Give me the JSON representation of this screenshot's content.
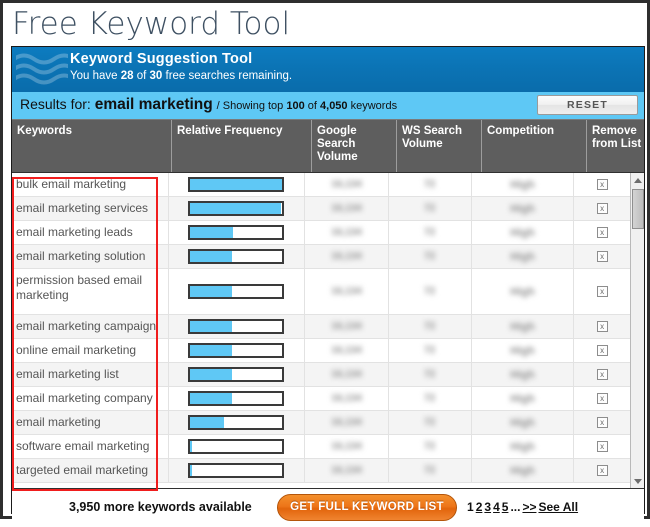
{
  "page": {
    "title": "Free Keyword Tool"
  },
  "brand": {
    "title": "Keyword Suggestion Tool",
    "subtitle_prefix": "You have ",
    "searches_used": "28",
    "subtitle_mid": " of ",
    "searches_total": "30",
    "subtitle_suffix": " free searches remaining.",
    "logo_icon": "waves-icon",
    "bg_color": "#0b73b4"
  },
  "results_bar": {
    "label": "Results for:",
    "keyword": "email marketing",
    "separator": "/",
    "showing_text": "Showing top ",
    "showing_count": "100",
    "showing_of": " of ",
    "total_keywords": "4,050",
    "showing_suffix": " keywords",
    "reset_label": "RESET",
    "bg_color": "#5ec8f5"
  },
  "table": {
    "headers": [
      "Keywords",
      "Relative Frequency",
      "Google Search Volume",
      "WS Search Volume",
      "Competition",
      "Remove from List"
    ],
    "header_bg": "#5e5e5e",
    "bar_color": "#5fc8f5",
    "remove_icon": "x-icon",
    "rows": [
      {
        "keyword": "bulk email marketing",
        "frequency_pct": 100,
        "google_volume": "16,134",
        "ws_volume": "72",
        "competition": "High",
        "remove": "x"
      },
      {
        "keyword": "email marketing services",
        "frequency_pct": 98,
        "google_volume": "16,134",
        "ws_volume": "72",
        "competition": "High",
        "remove": "x"
      },
      {
        "keyword": "email marketing leads",
        "frequency_pct": 46,
        "google_volume": "16,134",
        "ws_volume": "72",
        "competition": "High",
        "remove": "x"
      },
      {
        "keyword": "email marketing solution",
        "frequency_pct": 45,
        "google_volume": "16,134",
        "ws_volume": "72",
        "competition": "High",
        "remove": "x"
      },
      {
        "keyword": "permission based email marketing",
        "frequency_pct": 45,
        "google_volume": "16,134",
        "ws_volume": "72",
        "competition": "High",
        "remove": "x"
      },
      {
        "keyword": "email marketing campaign",
        "frequency_pct": 45,
        "google_volume": "16,134",
        "ws_volume": "72",
        "competition": "High",
        "remove": "x"
      },
      {
        "keyword": "online email marketing",
        "frequency_pct": 45,
        "google_volume": "16,134",
        "ws_volume": "72",
        "competition": "High",
        "remove": "x"
      },
      {
        "keyword": "email marketing list",
        "frequency_pct": 45,
        "google_volume": "16,134",
        "ws_volume": "72",
        "competition": "High",
        "remove": "x"
      },
      {
        "keyword": "email marketing company",
        "frequency_pct": 45,
        "google_volume": "16,134",
        "ws_volume": "72",
        "competition": "High",
        "remove": "x"
      },
      {
        "keyword": "email marketing",
        "frequency_pct": 36,
        "google_volume": "16,134",
        "ws_volume": "72",
        "competition": "High",
        "remove": "x"
      },
      {
        "keyword": "software email marketing",
        "frequency_pct": 2,
        "google_volume": "16,134",
        "ws_volume": "72",
        "competition": "High",
        "remove": "x"
      },
      {
        "keyword": "targeted email marketing",
        "frequency_pct": 2,
        "google_volume": "16,134",
        "ws_volume": "72",
        "competition": "High",
        "remove": "x"
      }
    ]
  },
  "footer": {
    "more_keywords": "3,950 more keywords available",
    "cta_label": "GET FULL KEYWORD LIST",
    "cta_color": "#ed7519",
    "pages": [
      "1",
      "2",
      "3",
      "4",
      "5"
    ],
    "ellipsis": "...",
    "next_label": ">>",
    "see_all_label": "See All",
    "current_page": "1"
  },
  "annotation": {
    "highlight_color": "#f01d1d"
  }
}
